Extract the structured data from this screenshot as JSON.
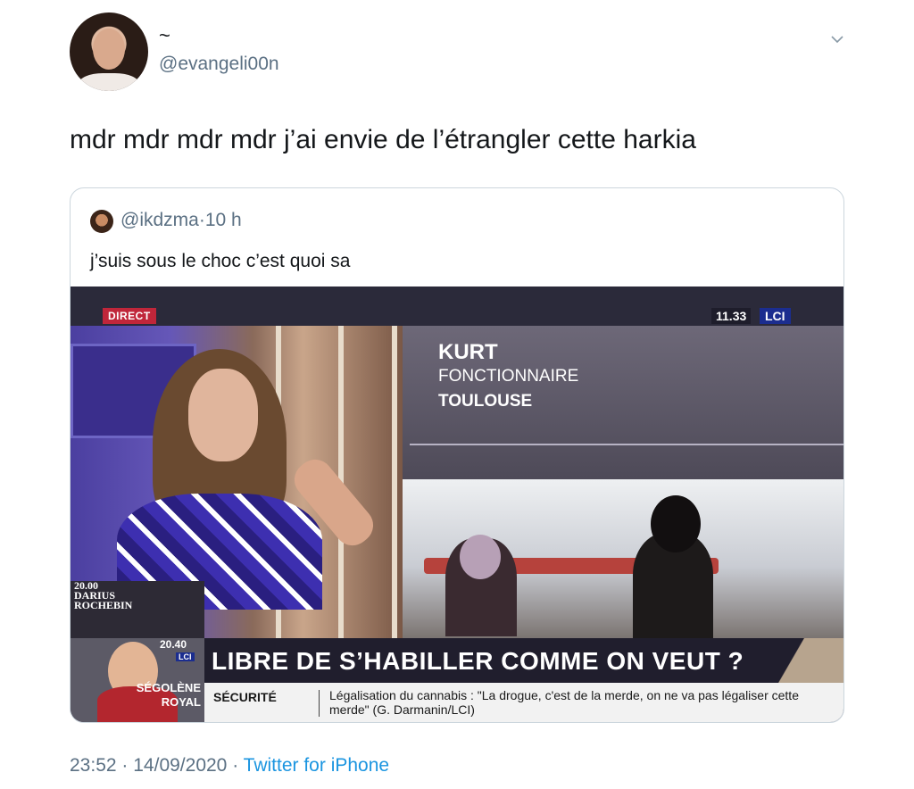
{
  "author": {
    "display_name": "~",
    "handle": "@evangeli00n"
  },
  "tweet": {
    "text": "mdr mdr mdr mdr j’ai envie de l’étrangler cette harkia",
    "time": "23:52",
    "date": "14/09/2020",
    "separator": "·",
    "source": "Twitter for iPhone"
  },
  "quoted": {
    "handle": "@ikdzma",
    "age": "10 h",
    "dot": "·",
    "text": "j’suis sous le choc c’est quoi sa"
  },
  "video": {
    "live_badge": "DIRECT",
    "clock": "11.33",
    "channel": "LCI",
    "inset_time": "20.00",
    "inset_name_1": "DARIUS",
    "inset_name_2": "ROCHEBIN",
    "speaker_name": "KURT",
    "speaker_role": "FONCTIONNAIRE",
    "speaker_city": "TOULOUSE",
    "small_time": "20.40",
    "small_channel": "LCI",
    "guest_first": "SÉGOLÈNE",
    "guest_last": "ROYAL",
    "headline": "LIBRE DE S’HABILLER COMME ON VEUT ?",
    "section": "SÉCURITÉ",
    "ticker": "Légalisation du cannabis : \"La drogue, c'est de la merde, on ne va pas légaliser cette merde\" (G. Darmanin/LCI)"
  },
  "colors": {
    "handle_gray": "#5b7083",
    "link_blue": "#1b95e0",
    "lci_blue": "#1b2d8f",
    "direct_red": "#c0263a"
  },
  "icons": [
    "chevron-down-icon"
  ]
}
